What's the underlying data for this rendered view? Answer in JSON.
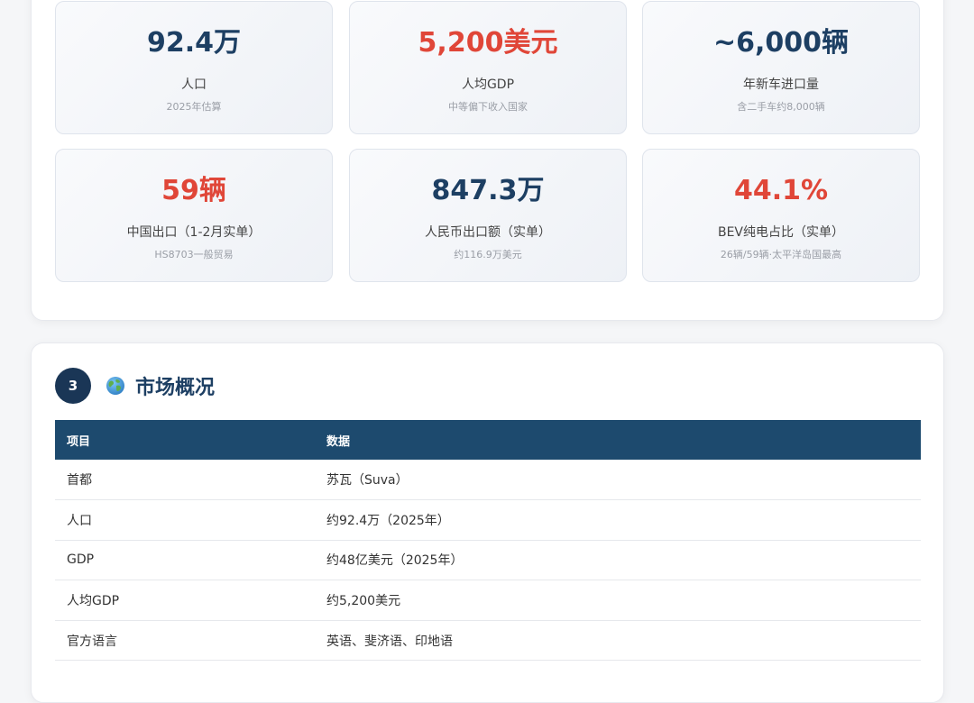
{
  "stats": [
    {
      "value": "92.4万",
      "label": "人口",
      "sub": "2025年估算",
      "color": "blue"
    },
    {
      "value": "5,200美元",
      "label": "人均GDP",
      "sub": "中等偏下收入国家",
      "color": "red"
    },
    {
      "value": "~6,000辆",
      "label": "年新车进口量",
      "sub": "含二手车约8,000辆",
      "color": "blue"
    },
    {
      "value": "59辆",
      "label": "中国出口（1-2月实单）",
      "sub": "HS8703一般贸易",
      "color": "red"
    },
    {
      "value": "847.3万",
      "label": "人民币出口额（实单）",
      "sub": "约116.9万美元",
      "color": "blue"
    },
    {
      "value": "44.1%",
      "label": "BEV纯电占比（实单）",
      "sub": "26辆/59辆·太平洋岛国最高",
      "color": "red"
    }
  ],
  "section": {
    "number": "3",
    "icon": "globe-icon",
    "title": "市场概况"
  },
  "table": {
    "headers": [
      "项目",
      "数据"
    ],
    "rows": [
      [
        "首都",
        "苏瓦（Suva）"
      ],
      [
        "人口",
        "约92.4万（2025年）"
      ],
      [
        "GDP",
        "约48亿美元（2025年）"
      ],
      [
        "人均GDP",
        "约5,200美元"
      ],
      [
        "官方语言",
        "英语、斐济语、印地语"
      ]
    ]
  },
  "colors": {
    "accent_blue": "#1d3f63",
    "accent_red": "#e04638",
    "table_header": "#1d4a6e"
  }
}
